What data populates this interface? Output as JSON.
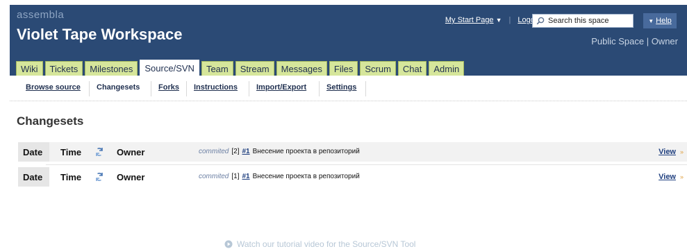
{
  "header": {
    "brand": "assembla",
    "workspace_title": "Violet Tape Workspace",
    "top_links": {
      "start_page": "My Start Page",
      "logout": "Logout"
    },
    "search": {
      "placeholder": "Search this space"
    },
    "help": "Help",
    "space_status": "Public Space | Owner"
  },
  "tabs": [
    {
      "label": "Wiki",
      "active": false
    },
    {
      "label": "Tickets",
      "active": false
    },
    {
      "label": "Milestones",
      "active": false
    },
    {
      "label": "Source/SVN",
      "active": true
    },
    {
      "label": "Team",
      "active": false
    },
    {
      "label": "Stream",
      "active": false
    },
    {
      "label": "Messages",
      "active": false
    },
    {
      "label": "Files",
      "active": false
    },
    {
      "label": "Scrum",
      "active": false
    },
    {
      "label": "Chat",
      "active": false
    },
    {
      "label": "Admin",
      "active": false
    }
  ],
  "subnav": [
    {
      "label": "Browse source",
      "active": false
    },
    {
      "label": "Changesets",
      "active": true
    },
    {
      "label": "Forks",
      "active": false
    },
    {
      "label": "Instructions",
      "active": false
    },
    {
      "label": "Import/Export",
      "active": false
    },
    {
      "label": "Settings",
      "active": false
    }
  ],
  "main": {
    "title": "Changesets",
    "changesets": [
      {
        "date": "Date",
        "time": "Time",
        "owner": "Owner",
        "verb": "commited",
        "revision": "[2]",
        "ticket": "#1",
        "message": "Внесение проекта в репозиторий",
        "view": "View"
      },
      {
        "date": "Date",
        "time": "Time",
        "owner": "Owner",
        "verb": "commited",
        "revision": "[1]",
        "ticket": "#1",
        "message": "Внесение проекта в репозиторий",
        "view": "View"
      }
    ]
  },
  "footer": {
    "tutorial_link": "Watch our tutorial video for the Source/SVN Tool"
  },
  "colors": {
    "header_bg": "#2b4a75",
    "tab_bg": "#d6e69b",
    "link": "#1f3f7f"
  },
  "icons": [
    "search-icon",
    "sync-icon",
    "play-icon",
    "dropdown-arrow-icon",
    "view-arrow-icon"
  ]
}
